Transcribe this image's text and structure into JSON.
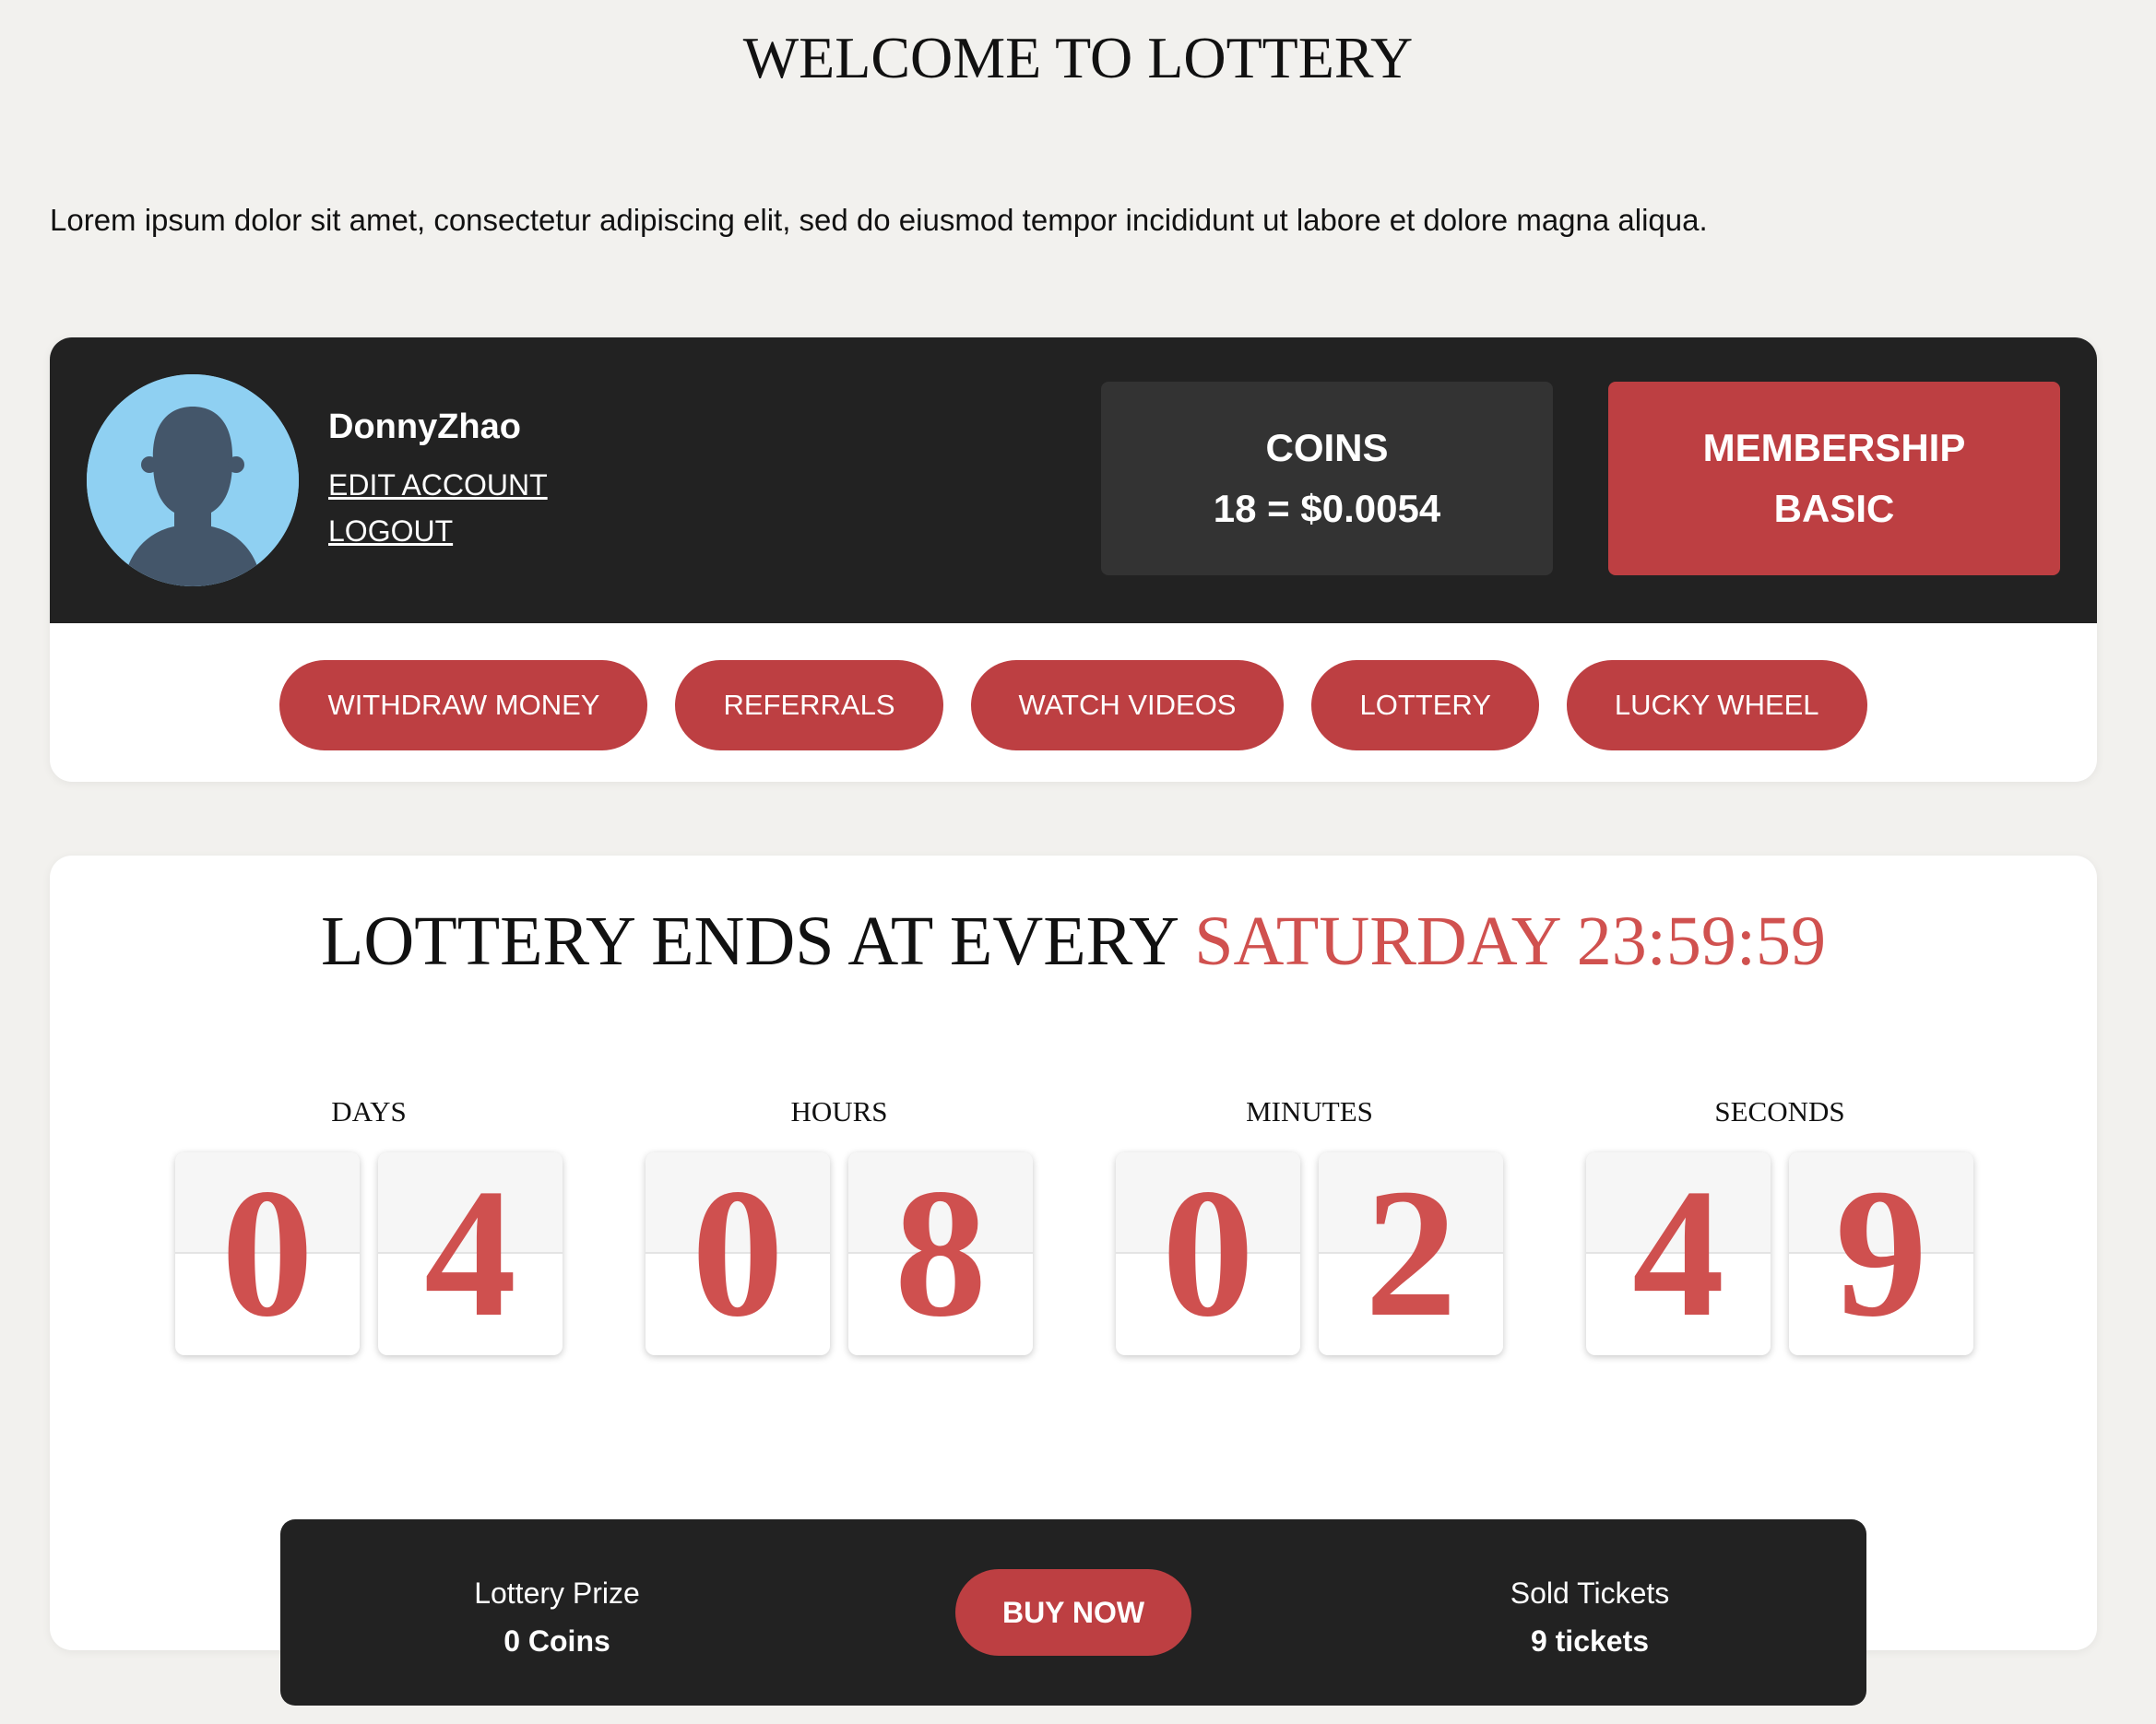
{
  "page": {
    "title": "WELCOME TO LOTTERY",
    "intro": "Lorem ipsum dolor sit amet, consectetur adipiscing elit, sed do eiusmod tempor incididunt ut labore et dolore magna aliqua."
  },
  "user": {
    "username": "DonnyZhao",
    "edit_account": "EDIT ACCOUNT",
    "logout": "LOGOUT",
    "avatar_icon": "user-silhouette-icon"
  },
  "stats": {
    "coins_label": "COINS",
    "coins_value": "18 = $0.0054",
    "membership_label": "MEMBERSHIP",
    "membership_value": "BASIC"
  },
  "nav": [
    {
      "label": "WITHDRAW MONEY"
    },
    {
      "label": "REFERRALS"
    },
    {
      "label": "WATCH VIDEOS"
    },
    {
      "label": "LOTTERY"
    },
    {
      "label": "LUCKY WHEEL"
    }
  ],
  "lottery": {
    "heading_prefix": "LOTTERY ENDS AT EVERY",
    "heading_accent": "SATURDAY 23:59:59",
    "countdown": [
      {
        "label": "DAYS",
        "digits": [
          "0",
          "4"
        ]
      },
      {
        "label": "HOURS",
        "digits": [
          "0",
          "8"
        ]
      },
      {
        "label": "MINUTES",
        "digits": [
          "0",
          "2"
        ]
      },
      {
        "label": "SECONDS",
        "digits": [
          "4",
          "9"
        ]
      }
    ]
  },
  "prize_bar": {
    "prize_label": "Lottery Prize",
    "prize_value": "0 Coins",
    "buy_label": "BUY NOW",
    "sold_label": "Sold Tickets",
    "sold_value": "9 tickets"
  },
  "colors": {
    "accent_red": "#bd3f42",
    "digit_red": "#cf504f",
    "dark": "#222222",
    "coins_box": "#333333",
    "avatar_bg": "#8fd0f2",
    "avatar_figure": "#44566a"
  }
}
